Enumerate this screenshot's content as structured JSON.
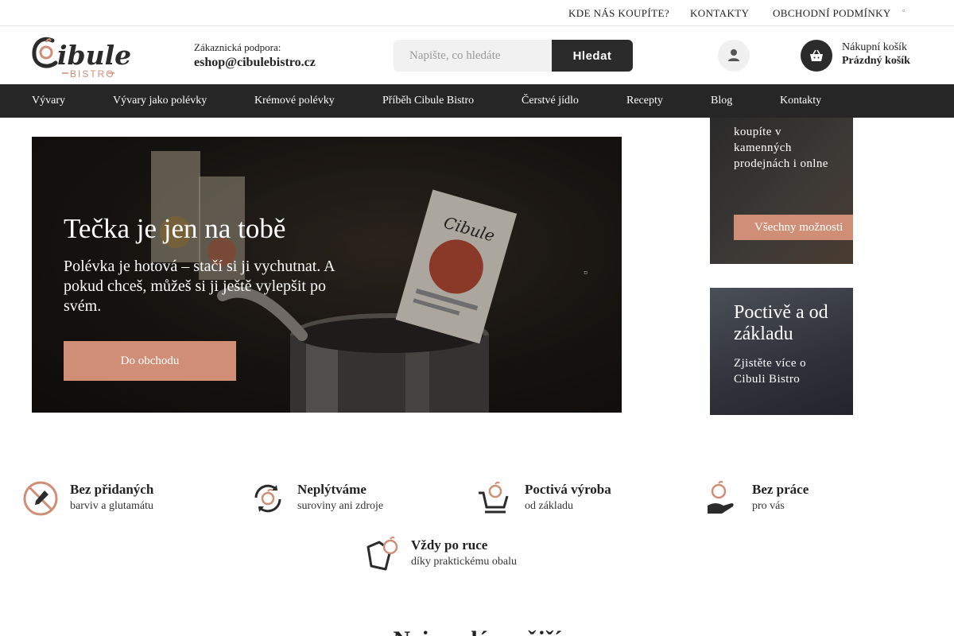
{
  "topbar": {
    "links": [
      "KDE NÁS KOUPÍTE?",
      "KONTAKTY",
      "OBCHODNÍ PODMÍNKY"
    ],
    "icon": "lock-icon"
  },
  "header": {
    "logo_text": "Cibule",
    "logo_sub": "BISTRO",
    "support_label": "Zákaznická podpora:",
    "support_email": "eshop@cibulebistro.cz",
    "search_placeholder": "Napište, co hledáte",
    "search_button": "Hledat",
    "cart_title": "Nákupní košík",
    "cart_status": "Prázdný košík"
  },
  "nav": {
    "items": [
      "Vývary",
      "Vývary jako polévky",
      "Krémové polévky",
      "Příběh Cibule Bistro",
      "Čerstvé jídlo",
      "Recepty",
      "Blog",
      "Kontakty"
    ]
  },
  "hero": {
    "title": "Tečka je jen na tobě",
    "subtitle": "Polévka je hotová – stačí si ji vychutnat. A pokud chceš, můžeš si ji ještě vylepšit po svém.",
    "cta": "Do obchodu",
    "next_icon": "chevron-right-icon"
  },
  "cards": {
    "stores_text": "koupíte v kamenných prodejnách i onlne",
    "stores_button": "Všechny možnosti",
    "story_title": "Poctivě a od základu",
    "story_sub": "Zjistěte více o Cibuli Bistro"
  },
  "features": [
    {
      "title": "Bez přidaných",
      "sub": "barviv a glutamátu",
      "icon": "no-additives-icon"
    },
    {
      "title": "Neplýtváme",
      "sub": "suroviny ani zdroje",
      "icon": "recycle-icon"
    },
    {
      "title": "Poctivá výroba",
      "sub": "od základu",
      "icon": "cart-onion-icon"
    },
    {
      "title": "Bez práce",
      "sub": "pro vás",
      "icon": "hand-onion-icon"
    },
    {
      "title": "Vždy po ruce",
      "sub": "díky praktickému obalu",
      "icon": "package-icon"
    }
  ],
  "section_title": "Nejprodávanější",
  "colors": {
    "accent": "#d08e76",
    "dark": "#262626"
  }
}
